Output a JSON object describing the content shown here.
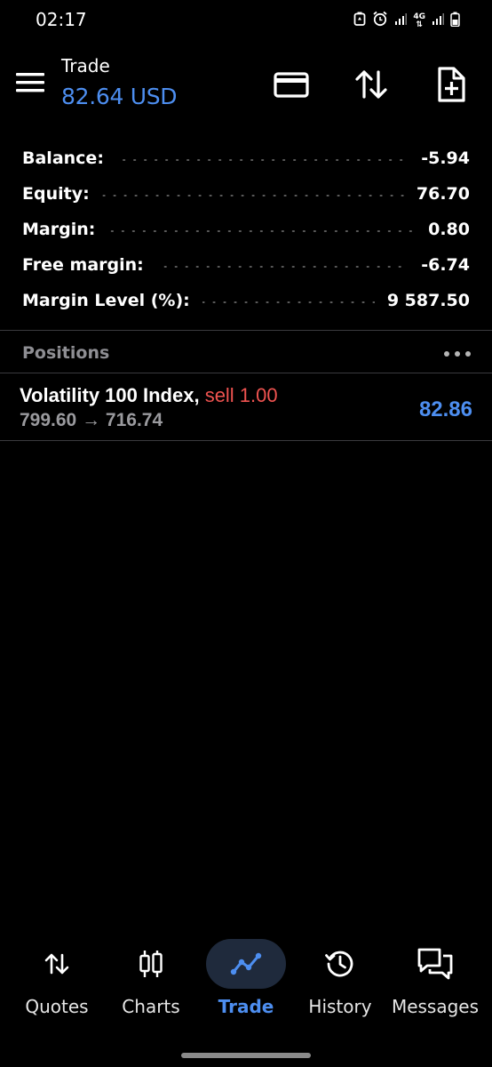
{
  "status_bar": {
    "time": "02:17",
    "network": "4G"
  },
  "header": {
    "title": "Trade",
    "balance": "82.64 USD"
  },
  "account": {
    "rows": [
      {
        "label": "Balance:",
        "value": "-5.94"
      },
      {
        "label": "Equity:",
        "value": "76.70"
      },
      {
        "label": "Margin:",
        "value": "0.80"
      },
      {
        "label": "Free margin:",
        "value": "-6.74"
      },
      {
        "label": "Margin Level (%):",
        "value": "9 587.50"
      }
    ]
  },
  "positions": {
    "title": "Positions",
    "items": [
      {
        "symbol": "Volatility 100 Index,",
        "side": "sell 1.00",
        "open_price": "799.60",
        "arrow": "→",
        "current_price": "716.74",
        "profit": "82.86"
      }
    ]
  },
  "nav": {
    "items": [
      {
        "label": "Quotes",
        "icon": "quotes-icon"
      },
      {
        "label": "Charts",
        "icon": "candlestick-icon"
      },
      {
        "label": "Trade",
        "icon": "trade-icon",
        "active": true
      },
      {
        "label": "History",
        "icon": "history-icon"
      },
      {
        "label": "Messages",
        "icon": "messages-icon"
      }
    ]
  },
  "colors": {
    "accent": "#4d8ef0",
    "sell": "#ef5350",
    "background": "#000000",
    "muted": "#8e8e93"
  }
}
